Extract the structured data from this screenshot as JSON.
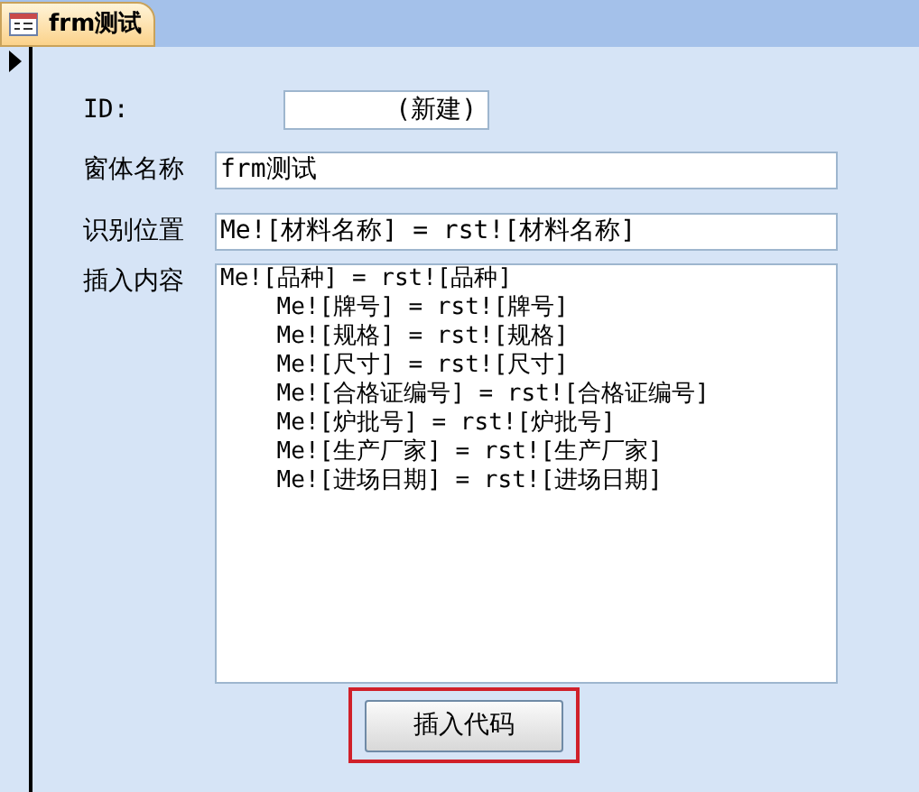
{
  "tab": {
    "title": "frm测试",
    "selected": true
  },
  "record_selector": {
    "current": true
  },
  "fields": [
    {
      "kind": "short",
      "label": "ID:",
      "value": "(新建)"
    },
    {
      "kind": "text",
      "label": "窗体名称",
      "value": "frm测试"
    },
    {
      "kind": "text",
      "label": "识别位置",
      "value": "Me![材料名称] = rst![材料名称]"
    },
    {
      "kind": "memo",
      "label": "插入内容",
      "lines": [
        "Me![品种] = rst![品种]",
        "    Me![牌号] = rst![牌号]",
        "    Me![规格] = rst![规格]",
        "    Me![尺寸] = rst![尺寸]",
        "    Me![合格证编号] = rst![合格证编号]",
        "    Me![炉批号] = rst![炉批号]",
        "    Me![生产厂家] = rst![生产厂家]",
        "    Me![进场日期] = rst![进场日期]"
      ]
    }
  ],
  "button": {
    "label": "插入代码",
    "highlighted": true
  }
}
